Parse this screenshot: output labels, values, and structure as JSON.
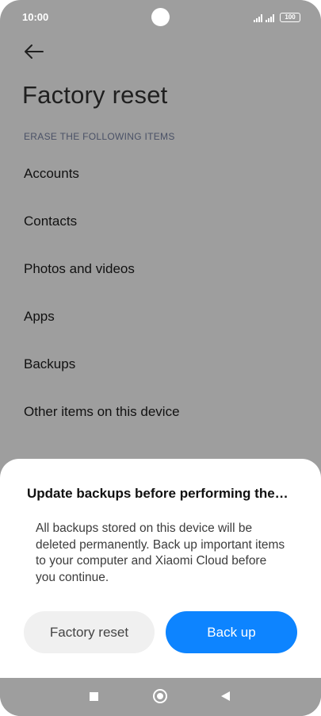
{
  "status_bar": {
    "time": "10:00",
    "battery": "100"
  },
  "header": {
    "back_icon": "arrow-left-icon",
    "title": "Factory reset"
  },
  "section": {
    "label": "ERASE THE FOLLOWING ITEMS",
    "items": [
      {
        "label": "Accounts"
      },
      {
        "label": "Contacts"
      },
      {
        "label": "Photos and videos"
      },
      {
        "label": "Apps"
      },
      {
        "label": "Backups"
      },
      {
        "label": "Other items on this device"
      }
    ]
  },
  "dialog": {
    "title": "Update backups before performing the…",
    "message": "All backups stored on this device will be deleted permanently. Back up important items to your computer and Xiaomi Cloud before you continue.",
    "secondary_button": "Factory reset",
    "primary_button": "Back up"
  },
  "nav_bar": {
    "recents_icon": "square-icon",
    "home_icon": "circle-icon",
    "back_icon": "triangle-back-icon"
  },
  "colors": {
    "accent": "#0d84ff",
    "scrim": "#9e9e9e",
    "sheet": "#ffffff"
  }
}
